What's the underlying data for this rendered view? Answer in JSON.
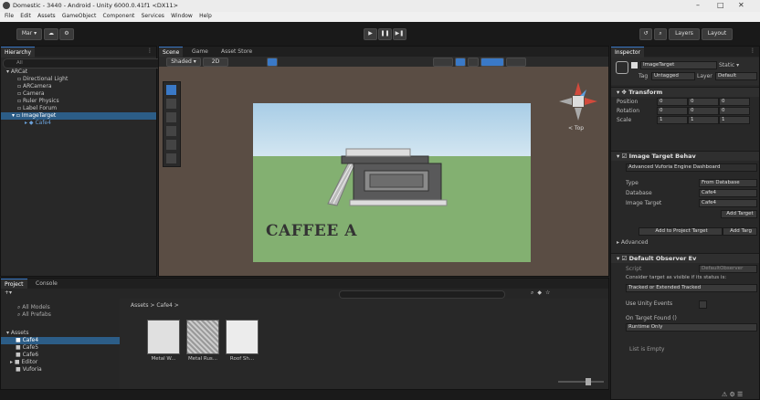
{
  "window": {
    "title": "Domestic - 3440 - Android - Unity 6000.0.41f1 <DX11>",
    "controls": [
      "–",
      "□",
      "✕"
    ]
  },
  "menu": [
    "File",
    "Edit",
    "Assets",
    "GameObject",
    "Component",
    "Services",
    "Window",
    "Help"
  ],
  "toolbar": {
    "account_label": "Mar ▾",
    "play": "▶",
    "pause": "❚❚",
    "step": "▶❚",
    "layers_label": "Layers",
    "layout_label": "Layout"
  },
  "hierarchy": {
    "tab": "Hierarchy",
    "search_placeholder": "All",
    "items": [
      {
        "label": "ARCat",
        "indent": 0
      },
      {
        "label": "Directional Light",
        "indent": 1
      },
      {
        "label": "ARCamera",
        "indent": 1
      },
      {
        "label": "Camera",
        "indent": 1
      },
      {
        "label": "Ruler Physics",
        "indent": 1
      },
      {
        "label": "Label Forum",
        "indent": 1
      },
      {
        "label": "ImageTarget",
        "indent": 1,
        "selected": true
      },
      {
        "label": "Cafe4",
        "indent": 2
      }
    ]
  },
  "scene": {
    "tabs": [
      "Scene",
      "Game",
      "Asset Store"
    ],
    "shading_label": "Shaded ▾",
    "mode_label": "2D",
    "persp_label": "< Top",
    "image_text": "CAFFEE A"
  },
  "project": {
    "tabs": [
      "Project",
      "Console"
    ],
    "breadcrumb": "Assets > Cafe4 >",
    "favorites": [
      "All Models",
      "All Prefabs"
    ],
    "assets_root": "Assets",
    "folders": [
      "Cafe4",
      "Cafe5",
      "Cafe6",
      "Editor",
      "Vuforia"
    ],
    "files": [
      "Metal W...",
      "Metal Rus...",
      "Roof Sh..."
    ]
  },
  "inspector": {
    "tab": "Inspector",
    "object_name": "ImageTarget",
    "static_label": "Static ▾",
    "tag_label": "Tag",
    "tag_value": "Untagged",
    "layer_label": "Layer",
    "layer_value": "Default",
    "transform": {
      "title": "Transform",
      "rows": [
        {
          "label": "Position",
          "x": "0",
          "y": "0",
          "z": "0"
        },
        {
          "label": "Rotation",
          "x": "0",
          "y": "0",
          "z": "0"
        },
        {
          "label": "Scale",
          "x": "1",
          "y": "1",
          "z": "1"
        }
      ]
    },
    "image_target": {
      "title": "Image Target Behav",
      "info": "Advanced Vuforia Engine Dashboard",
      "type_label": "Type",
      "type_value": "From Database",
      "database_label": "Database",
      "database_value": "Cafe4",
      "target_label": "Image Target",
      "target_value": "Cafe4",
      "add_button": "Add Target",
      "db_button": "Add to Project Target",
      "db_button2": "Add Targ",
      "advanced_label": "Advanced"
    },
    "observer": {
      "title": "Default Observer Ev",
      "script_label": "Script",
      "script_value": "DefaultObserver",
      "consider_label": "Consider target as visible if its status is:",
      "consider_value": "Tracked or Extended Tracked",
      "use_cb_label": "Use Unity Events",
      "on_found_label": "On Target Found ()",
      "runtime_label": "Runtime Only",
      "list_empty": "List is Empty"
    }
  }
}
